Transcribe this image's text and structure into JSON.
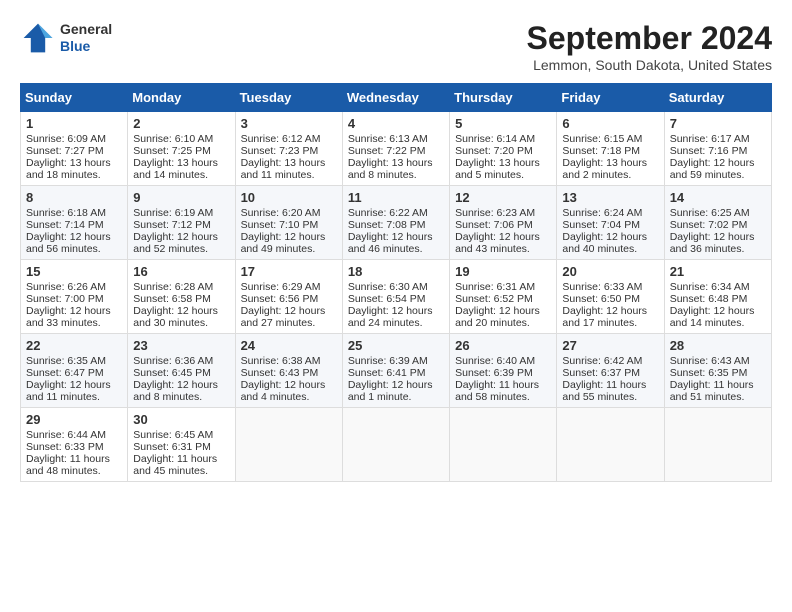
{
  "header": {
    "logo_general": "General",
    "logo_blue": "Blue",
    "month_title": "September 2024",
    "location": "Lemmon, South Dakota, United States"
  },
  "days_of_week": [
    "Sunday",
    "Monday",
    "Tuesday",
    "Wednesday",
    "Thursday",
    "Friday",
    "Saturday"
  ],
  "weeks": [
    [
      {
        "day": "1",
        "sunrise": "6:09 AM",
        "sunset": "7:27 PM",
        "daylight": "13 hours and 18 minutes."
      },
      {
        "day": "2",
        "sunrise": "6:10 AM",
        "sunset": "7:25 PM",
        "daylight": "13 hours and 14 minutes."
      },
      {
        "day": "3",
        "sunrise": "6:12 AM",
        "sunset": "7:23 PM",
        "daylight": "13 hours and 11 minutes."
      },
      {
        "day": "4",
        "sunrise": "6:13 AM",
        "sunset": "7:22 PM",
        "daylight": "13 hours and 8 minutes."
      },
      {
        "day": "5",
        "sunrise": "6:14 AM",
        "sunset": "7:20 PM",
        "daylight": "13 hours and 5 minutes."
      },
      {
        "day": "6",
        "sunrise": "6:15 AM",
        "sunset": "7:18 PM",
        "daylight": "13 hours and 2 minutes."
      },
      {
        "day": "7",
        "sunrise": "6:17 AM",
        "sunset": "7:16 PM",
        "daylight": "12 hours and 59 minutes."
      }
    ],
    [
      {
        "day": "8",
        "sunrise": "6:18 AM",
        "sunset": "7:14 PM",
        "daylight": "12 hours and 56 minutes."
      },
      {
        "day": "9",
        "sunrise": "6:19 AM",
        "sunset": "7:12 PM",
        "daylight": "12 hours and 52 minutes."
      },
      {
        "day": "10",
        "sunrise": "6:20 AM",
        "sunset": "7:10 PM",
        "daylight": "12 hours and 49 minutes."
      },
      {
        "day": "11",
        "sunrise": "6:22 AM",
        "sunset": "7:08 PM",
        "daylight": "12 hours and 46 minutes."
      },
      {
        "day": "12",
        "sunrise": "6:23 AM",
        "sunset": "7:06 PM",
        "daylight": "12 hours and 43 minutes."
      },
      {
        "day": "13",
        "sunrise": "6:24 AM",
        "sunset": "7:04 PM",
        "daylight": "12 hours and 40 minutes."
      },
      {
        "day": "14",
        "sunrise": "6:25 AM",
        "sunset": "7:02 PM",
        "daylight": "12 hours and 36 minutes."
      }
    ],
    [
      {
        "day": "15",
        "sunrise": "6:26 AM",
        "sunset": "7:00 PM",
        "daylight": "12 hours and 33 minutes."
      },
      {
        "day": "16",
        "sunrise": "6:28 AM",
        "sunset": "6:58 PM",
        "daylight": "12 hours and 30 minutes."
      },
      {
        "day": "17",
        "sunrise": "6:29 AM",
        "sunset": "6:56 PM",
        "daylight": "12 hours and 27 minutes."
      },
      {
        "day": "18",
        "sunrise": "6:30 AM",
        "sunset": "6:54 PM",
        "daylight": "12 hours and 24 minutes."
      },
      {
        "day": "19",
        "sunrise": "6:31 AM",
        "sunset": "6:52 PM",
        "daylight": "12 hours and 20 minutes."
      },
      {
        "day": "20",
        "sunrise": "6:33 AM",
        "sunset": "6:50 PM",
        "daylight": "12 hours and 17 minutes."
      },
      {
        "day": "21",
        "sunrise": "6:34 AM",
        "sunset": "6:48 PM",
        "daylight": "12 hours and 14 minutes."
      }
    ],
    [
      {
        "day": "22",
        "sunrise": "6:35 AM",
        "sunset": "6:47 PM",
        "daylight": "12 hours and 11 minutes."
      },
      {
        "day": "23",
        "sunrise": "6:36 AM",
        "sunset": "6:45 PM",
        "daylight": "12 hours and 8 minutes."
      },
      {
        "day": "24",
        "sunrise": "6:38 AM",
        "sunset": "6:43 PM",
        "daylight": "12 hours and 4 minutes."
      },
      {
        "day": "25",
        "sunrise": "6:39 AM",
        "sunset": "6:41 PM",
        "daylight": "12 hours and 1 minute."
      },
      {
        "day": "26",
        "sunrise": "6:40 AM",
        "sunset": "6:39 PM",
        "daylight": "11 hours and 58 minutes."
      },
      {
        "day": "27",
        "sunrise": "6:42 AM",
        "sunset": "6:37 PM",
        "daylight": "11 hours and 55 minutes."
      },
      {
        "day": "28",
        "sunrise": "6:43 AM",
        "sunset": "6:35 PM",
        "daylight": "11 hours and 51 minutes."
      }
    ],
    [
      {
        "day": "29",
        "sunrise": "6:44 AM",
        "sunset": "6:33 PM",
        "daylight": "11 hours and 48 minutes."
      },
      {
        "day": "30",
        "sunrise": "6:45 AM",
        "sunset": "6:31 PM",
        "daylight": "11 hours and 45 minutes."
      },
      null,
      null,
      null,
      null,
      null
    ]
  ]
}
